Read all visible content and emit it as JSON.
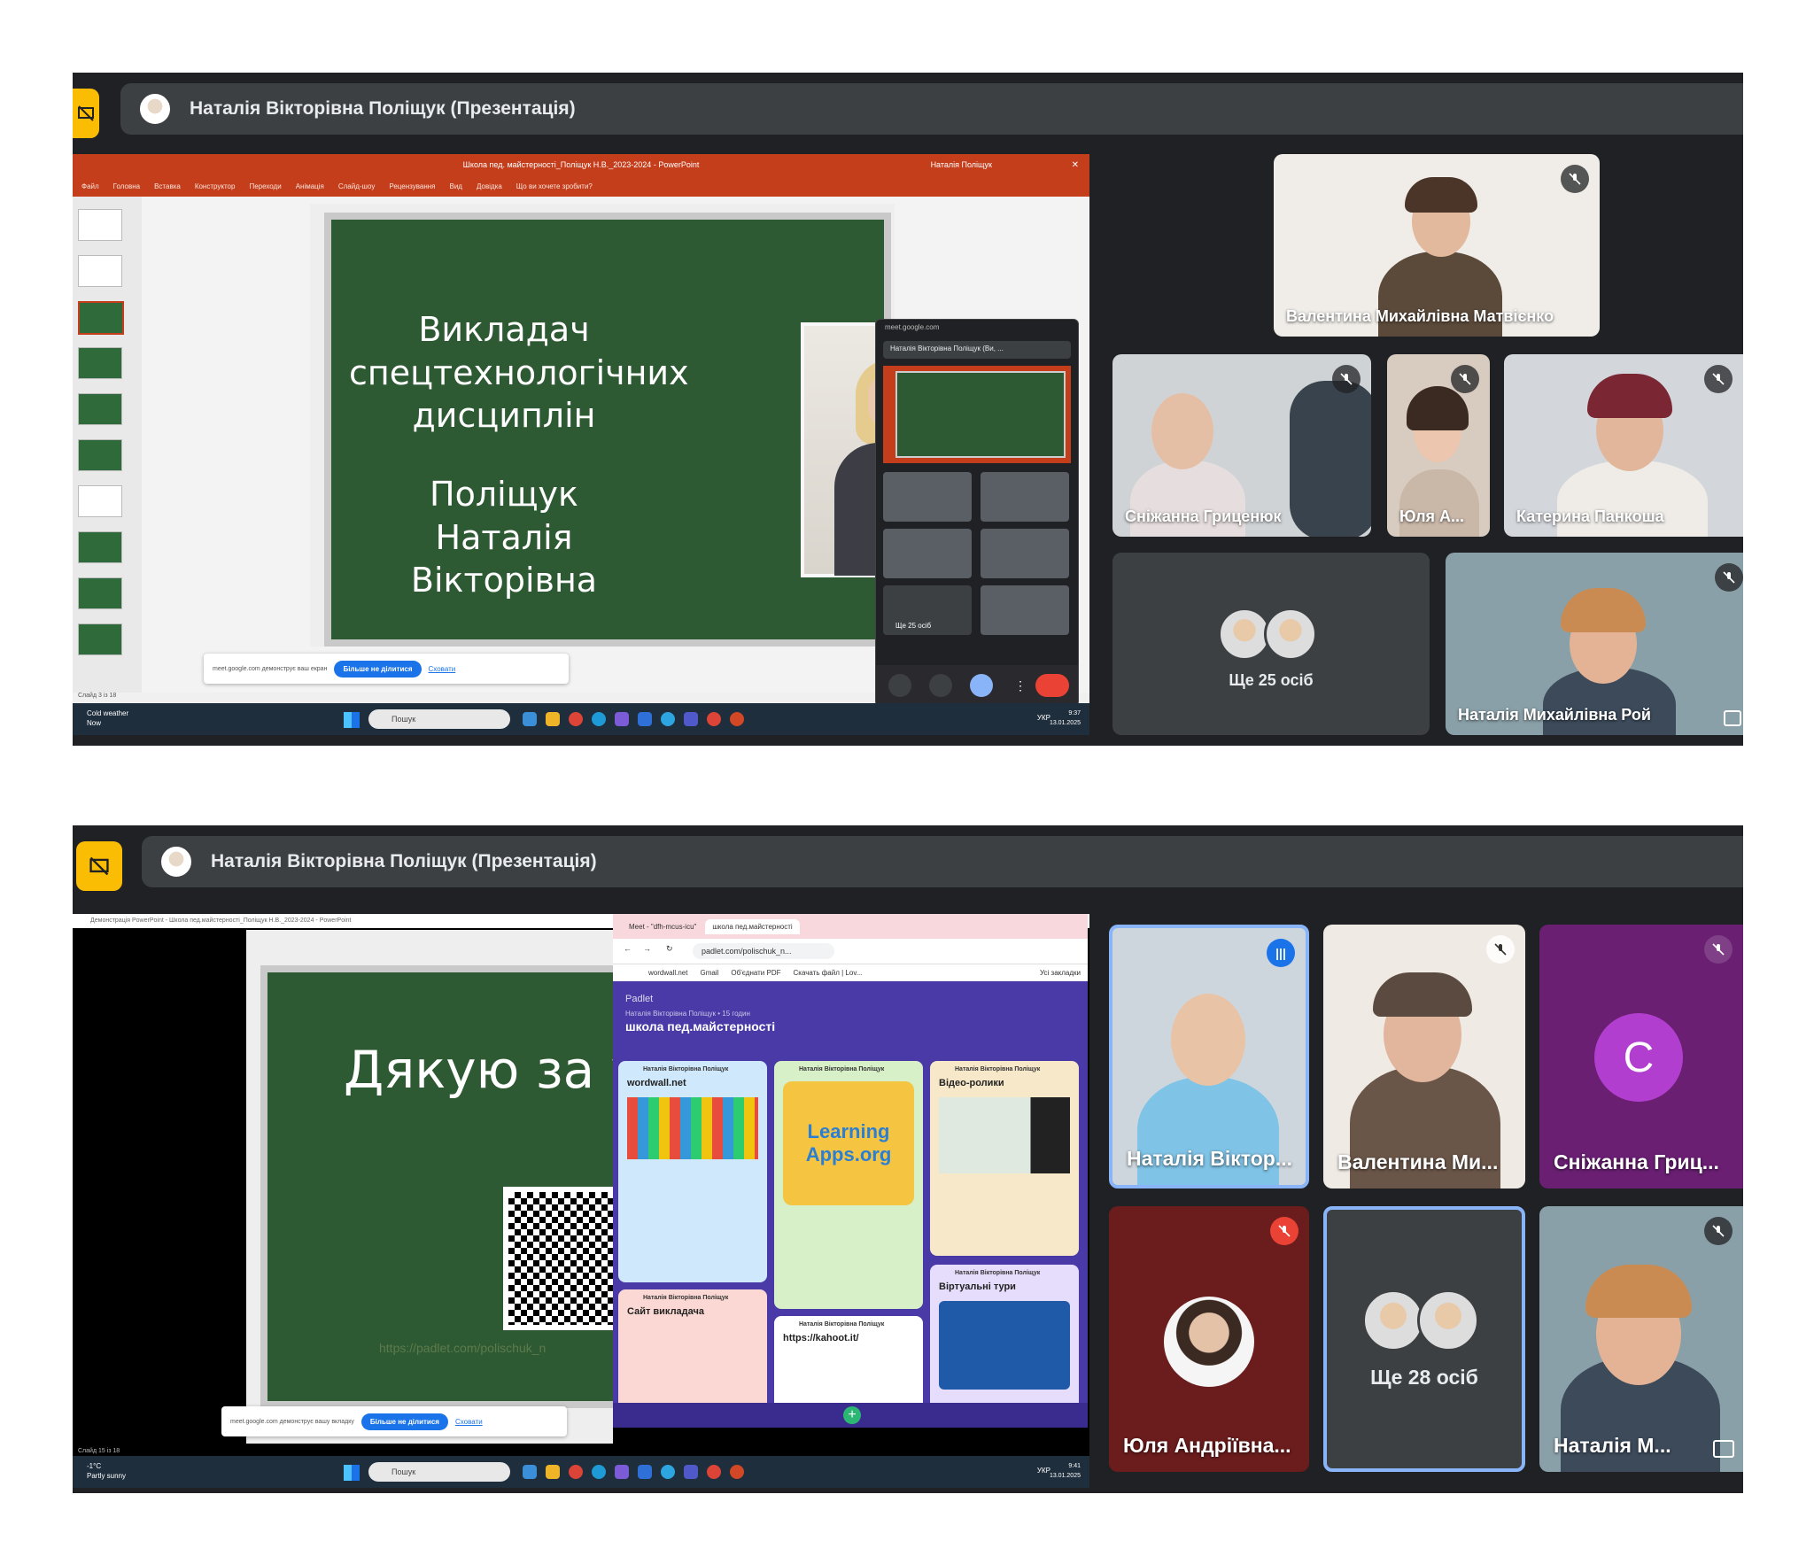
{
  "colors": {
    "panel_bg": "#202124",
    "accent": "#fbbc04",
    "tile": "#3c4043",
    "ppt": "#c43e1c",
    "padlet": "#4a3aa8"
  },
  "icons": {
    "present": "screen-share-off-icon",
    "mute": "mic-off-icon",
    "speaking": "audio-level-icon",
    "pin": "pip-icon"
  },
  "panel1": {
    "presenter": "Наталія Вікторівна Поліщук (Презентація)",
    "ppt_title": "Школа пед. майстерності_Поліщук Н.В._2023-2024 - PowerPoint",
    "ppt_user": "Наталія Поліщук",
    "ppt_menu": [
      "Файл",
      "Головна",
      "Вставка",
      "Конструктор",
      "Переходи",
      "Анімація",
      "Слайд-шоу",
      "Рецензування",
      "Вид",
      "Довідка",
      "Що ви хочете зробити?"
    ],
    "slide_line1": "Викладач",
    "slide_line2": "спецтехнологічних",
    "slide_line3": "дисциплін",
    "slide_line4": "Поліщук",
    "slide_line5": "Наталія Вікторівна",
    "share_msg": "meet.google.com демонструє ваш екран",
    "share_stop": "Більше не ділитися",
    "share_hide": "Сховати",
    "slide_status": "Слайд 3 із 18",
    "weather": "Cold weather",
    "weather2": "Now",
    "search": "Пошук",
    "tray": "УКР",
    "time": "9:37",
    "date": "13.01.2025",
    "mini_url": "meet.google.com",
    "mini_name": "Наталія Вікторівна Поліщук (Ви, ...",
    "mini_more": "Ще 25 осіб",
    "tiles": [
      {
        "name": "Валентина Михайлівна Матвієнко"
      },
      {
        "name": "Сніжанна Гриценюк"
      },
      {
        "name": "Юля А..."
      },
      {
        "name": "Катерина Панкоша"
      },
      {
        "name": "Ще 25 осіб"
      },
      {
        "name": "Наталія Михайлівна Рой"
      }
    ]
  },
  "panel2": {
    "presenter": "Наталія Вікторівна Поліщук (Презентація)",
    "ppt_title": "Демонстрація PowerPoint - Школа пед.майстерності_Поліщук Н.В._2023-2024 - PowerPoint",
    "slide_text": "Дякую за увагу",
    "slide_url": "https://padlet.com/polischuk_n",
    "tab1": "Meet - \"dfh-mcus-icu\"",
    "tab2": "школа пед.майстерності",
    "url": "padlet.com/polischuk_n...",
    "bookmarks": [
      "wordwall.net",
      "Gmail",
      "Об'єднати PDF",
      "Скачать файл | Lov...",
      "Усі закладки"
    ],
    "padlet_brand": "Padlet",
    "padlet_author": "Наталія Вікторівна Поліщук • 15 годин",
    "padlet_title": "школа пед.майстерності",
    "cards": [
      {
        "author": "Наталія Вікторівна Поліщук",
        "title": "wordwall.net"
      },
      {
        "author": "Наталія Вікторівна Поліщук",
        "title": "Learning Apps.org"
      },
      {
        "author": "Наталія Вікторівна Поліщук",
        "title": "Відео-ролики"
      },
      {
        "author": "Наталія Вікторівна Поліщук",
        "title": "Сайт викладача"
      },
      {
        "author": "Наталія Вікторівна Поліщук",
        "title": "https://kahoot.it/"
      },
      {
        "author": "Наталія Вікторівна Поліщук",
        "title": "Віртуальні тури"
      }
    ],
    "share_msg": "meet.google.com демонструє вашу вкладку",
    "share_stop": "Більше не ділитися",
    "share_hide": "Сховати",
    "slide_status": "Слайд 15 із 18",
    "weather": "-1°C",
    "weather2": "Partly sunny",
    "search": "Пошук",
    "tray": "УКР",
    "time": "9:41",
    "date": "13.01.2025",
    "tiles": [
      {
        "name": "Наталія Віктор..."
      },
      {
        "name": "Валентина Ми..."
      },
      {
        "name": "Сніжанна Гриц...",
        "initial": "С"
      },
      {
        "name": "Юля Андріївна..."
      },
      {
        "name": "Ще 28 осіб"
      },
      {
        "name": "Наталія М..."
      }
    ]
  }
}
